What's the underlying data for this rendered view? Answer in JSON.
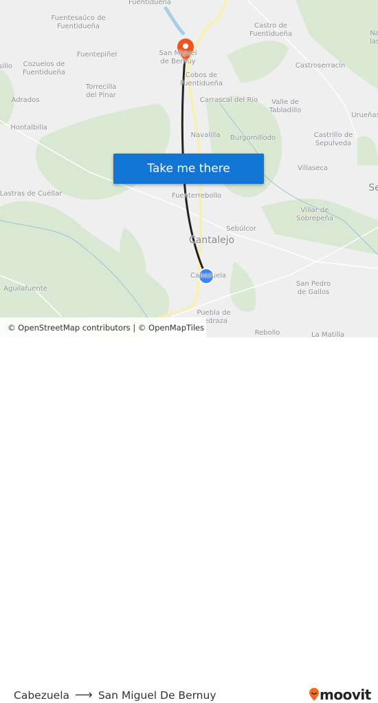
{
  "map": {
    "place_labels": [
      "Fuentidueña",
      "Fuentesaúco de\nFuentidueña",
      "Fuentepiñel",
      "Cozuelos de\nFuentidueña",
      "sillo",
      "Torrecilla\ndel Pinar",
      "Adrados",
      "Hontalbilla",
      "Castro de\nFuentidueña",
      "Castroserracín",
      "Na\nlas",
      "San Miguel\nde Bernuy",
      "Cobos de\nFuentidueña",
      "Carrascal del Río",
      "Valle de\nTabladillo",
      "Urueñas",
      "Castrillo de\nSepulveda",
      "Navalilla",
      "Burgomillodo",
      "Villaseca",
      "Se",
      "Lastras de Cuéllar",
      "Fuenterrebollo",
      "Villar de\nSobrepeña",
      "Sebúlcor",
      "Cantalejo",
      "Cabezuela",
      "Aguilafuente",
      "San Pedro\nde Gallos",
      "Puebla de\nPedraza",
      "Rebollo",
      "La Matilla"
    ],
    "origin_marker": "blue-dot-origin",
    "destination_marker": "orange-pin-destination",
    "route_color": "#222222",
    "origin_color": "#3b82f6",
    "destination_color": "#f0541e"
  },
  "cta": {
    "label": "Take me there",
    "color": "#1275d6"
  },
  "attribution": "© OpenStreetMap contributors | © OpenMapTiles",
  "footer": {
    "origin": "Cabezuela",
    "arrow_icon": "arrow-right",
    "destination": "San Miguel De Bernuy",
    "logo_text": "moovit",
    "logo_color": "#f26b21"
  }
}
